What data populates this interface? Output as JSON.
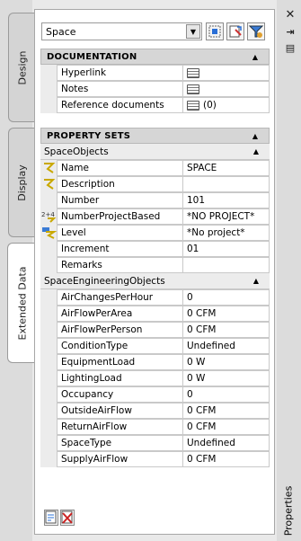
{
  "tabs": [
    "Design",
    "Display",
    "Extended Data"
  ],
  "object_type": "Space",
  "right_panel_label": "Properties",
  "sections": {
    "documentation": {
      "title": "DOCUMENTATION",
      "rows": [
        {
          "name": "Hyperlink",
          "value": ""
        },
        {
          "name": "Notes",
          "value": ""
        },
        {
          "name": "Reference documents",
          "value": "(0)"
        }
      ]
    },
    "property_sets": {
      "title": "PROPERTY SETS",
      "space_objects": {
        "title": "SpaceObjects",
        "rows": [
          {
            "name": "Name",
            "value": "SPACE"
          },
          {
            "name": "Description",
            "value": ""
          },
          {
            "name": "Number",
            "value": "101"
          },
          {
            "name": "NumberProjectBased",
            "value": "*NO PROJECT*"
          },
          {
            "name": "Level",
            "value": "*No project*"
          },
          {
            "name": "Increment",
            "value": "01"
          },
          {
            "name": "Remarks",
            "value": ""
          }
        ]
      },
      "space_engineering": {
        "title": "SpaceEngineeringObjects",
        "rows": [
          {
            "name": "AirChangesPerHour",
            "value": "0"
          },
          {
            "name": "AirFlowPerArea",
            "value": "0 CFM"
          },
          {
            "name": "AirFlowPerPerson",
            "value": "0 CFM"
          },
          {
            "name": "ConditionType",
            "value": "Undefined"
          },
          {
            "name": "EquipmentLoad",
            "value": "0 W"
          },
          {
            "name": "LightingLoad",
            "value": "0 W"
          },
          {
            "name": "Occupancy",
            "value": "0"
          },
          {
            "name": "OutsideAirFlow",
            "value": "0 CFM"
          },
          {
            "name": "ReturnAirFlow",
            "value": "0 CFM"
          },
          {
            "name": "SpaceType",
            "value": "Undefined"
          },
          {
            "name": "SupplyAirFlow",
            "value": "0 CFM"
          }
        ]
      }
    }
  }
}
